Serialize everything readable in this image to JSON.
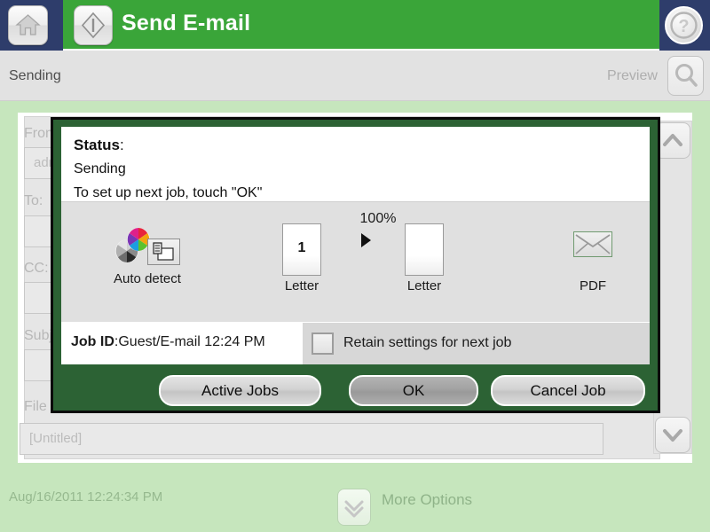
{
  "header": {
    "title": "Send E-mail",
    "home_icon": "home-icon",
    "start_icon": "start-diamond-icon",
    "help_icon": "help-question-icon",
    "band_color": "#3aa539",
    "bar_color": "#2e3d6b"
  },
  "statusbar": {
    "status": "Sending",
    "preview_label": "Preview",
    "preview_icon": "magnifier-icon"
  },
  "form": {
    "fields": [
      {
        "label": "From:",
        "value": "admin"
      },
      {
        "label": "To:",
        "value": ""
      },
      {
        "label": "CC:",
        "value": ""
      },
      {
        "label": "Subject:",
        "value": ""
      },
      {
        "label": "File Name:",
        "value": "[Untitled]"
      }
    ],
    "scroll_up_icon": "chevron-up-icon",
    "scroll_down_icon": "chevron-down-icon"
  },
  "dialog": {
    "status_title": "Status",
    "status_colon": ":",
    "status_value": "Sending",
    "instruction": "To set up next job, touch \"OK\"",
    "icons": {
      "color_mode_label": "Auto detect",
      "color_mode_icon": "color-wheel-icon",
      "scan_doc_icon": "scan-document-icon",
      "input_page_label": "Letter",
      "input_page_number": "1",
      "scale_percent": "100%",
      "arrow_icon": "arrow-right-icon",
      "output_page_label": "Letter",
      "file_type_label": "PDF",
      "file_type_icon": "envelope-icon"
    },
    "jobid_label": "Job ID",
    "jobid_colon": ":",
    "jobid_value": "Guest/E-mail 12:24 PM",
    "retain_label": "Retain settings for next job",
    "retain_checked": false,
    "buttons": {
      "active_jobs": "Active Jobs",
      "ok": "OK",
      "cancel": "Cancel Job"
    },
    "border_color": "#2c6234"
  },
  "footer": {
    "datetime": "Aug/16/2011 12:24:34 PM",
    "more_options": "More Options",
    "more_icon": "double-chevron-down-icon"
  }
}
